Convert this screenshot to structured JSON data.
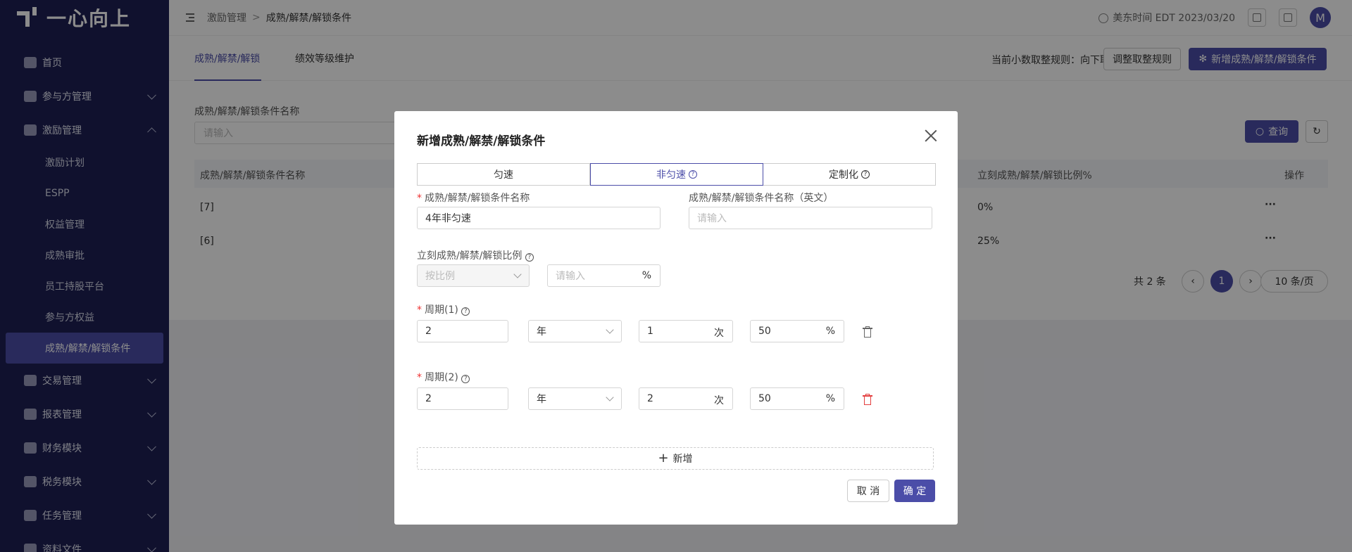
{
  "logo": {
    "text": "一心向上"
  },
  "sidebar": {
    "items": [
      {
        "label": "首页",
        "icon": "home-icon"
      },
      {
        "label": "参与方管理",
        "icon": "users-icon"
      },
      {
        "label": "激励管理",
        "icon": "gift-icon",
        "expanded": true
      },
      {
        "label": "交易管理",
        "icon": "shield-icon"
      },
      {
        "label": "报表管理",
        "icon": "report-icon"
      },
      {
        "label": "财务模块",
        "icon": "finance-icon"
      },
      {
        "label": "税务模块",
        "icon": "tax-icon"
      },
      {
        "label": "任务管理",
        "icon": "task-icon"
      },
      {
        "label": "资料文件",
        "icon": "folder-icon"
      }
    ],
    "subitems": [
      "激励计划",
      "ESPP",
      "权益管理",
      "成熟审批",
      "员工持股平台",
      "参与方权益",
      "成熟/解禁/解锁条件"
    ]
  },
  "topbar": {
    "breadcrumb_parent": "激励管理",
    "breadcrumb_sep": ">",
    "breadcrumb_current": "成熟/解禁/解锁条件",
    "timezone": "美东时间 EDT 2023/03/20",
    "avatar": "M"
  },
  "page": {
    "tabs": [
      "成熟/解禁/解锁",
      "绩效等级维护"
    ],
    "rounding_rule": "当前小数取整规则：向下取整",
    "adjust_button": "调整取整规则",
    "new_button": "新增成熟/解禁/解锁条件",
    "filter_label": "成熟/解禁/解锁条件名称",
    "filter_placeholder": "请输入",
    "search_button": "查询",
    "columns": {
      "name": "成熟/解禁/解锁条件名称",
      "ratio": "立刻成熟/解禁/解锁比例%",
      "ops": "操作"
    },
    "rows": [
      {
        "name": "[7]",
        "ratio": "0%",
        "ops": "···"
      },
      {
        "name": "[6]",
        "ratio": "25%",
        "ops": "···"
      }
    ],
    "pagination": {
      "total": "共 2 条",
      "current": "1",
      "page_size": "10 条/页"
    }
  },
  "modal": {
    "title": "新增成熟/解禁/解锁条件",
    "segments": [
      "匀速",
      "非匀速",
      "定制化"
    ],
    "name_label": "成熟/解禁/解锁条件名称",
    "name_value": "4年非匀速",
    "name_en_label": "成熟/解禁/解锁条件名称（英文）",
    "name_en_placeholder": "请输入",
    "immediate_label": "立刻成熟/解禁/解锁比例",
    "immediate_select": "按比例",
    "immediate_placeholder": "请输入",
    "percent": "%",
    "periods": [
      {
        "label": "周期(1)",
        "value": "2",
        "unit": "年",
        "count": "1",
        "count_unit": "次",
        "ratio": "50"
      },
      {
        "label": "周期(2)",
        "value": "2",
        "unit": "年",
        "count": "2",
        "count_unit": "次",
        "ratio": "50"
      }
    ],
    "add_label": "新增",
    "cancel": "取 消",
    "confirm": "确 定"
  },
  "colors": {
    "primary": "#4b4da8",
    "sidebar": "#1e2055",
    "danger": "#e33e3e"
  }
}
